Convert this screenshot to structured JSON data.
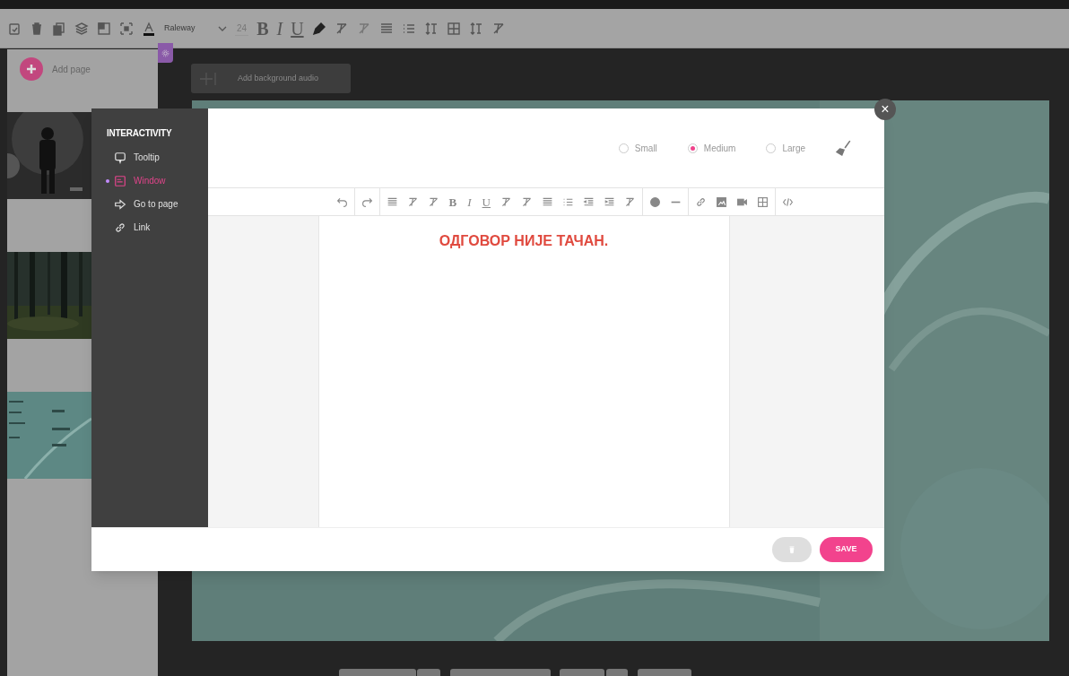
{
  "top_toolbar": {
    "font": "Raleway",
    "size": "24",
    "format_buttons": [
      "B",
      "I",
      "U"
    ]
  },
  "pages_panel": {
    "add_page": "Add page"
  },
  "audio_button": {
    "label": "Add background audio"
  },
  "modal": {
    "close": "×",
    "sidebar": {
      "title": "INTERACTIVITY",
      "items": [
        {
          "label": "Tooltip",
          "kind": "tooltip",
          "selected": false
        },
        {
          "label": "Window",
          "kind": "window",
          "selected": true
        },
        {
          "label": "Go to page",
          "kind": "goto",
          "selected": false
        },
        {
          "label": "Link",
          "kind": "link",
          "selected": false
        }
      ]
    },
    "sizes": [
      {
        "label": "Small",
        "selected": false
      },
      {
        "label": "Medium",
        "selected": true
      },
      {
        "label": "Large",
        "selected": false
      }
    ],
    "editor_toolbar": {
      "format_buttons": [
        "B",
        "I",
        "U"
      ]
    },
    "content": "ОДГОВОР НИЈЕ ТАЧАН.",
    "save": "SAVE"
  }
}
